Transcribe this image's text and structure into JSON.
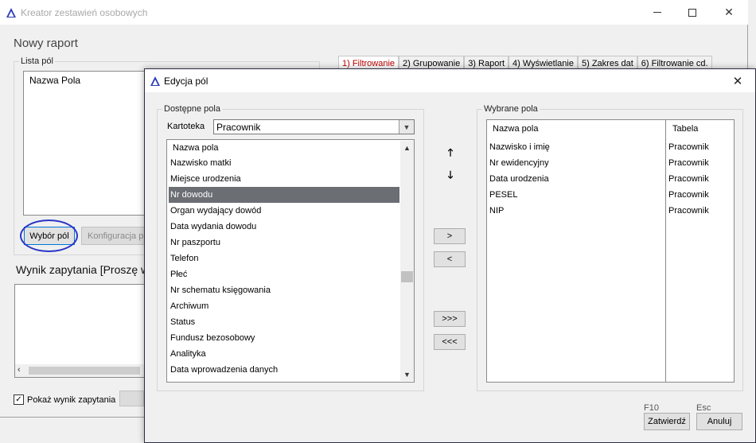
{
  "main_window": {
    "title": "Kreator zestawień osobowych",
    "report_title": "Nowy raport",
    "fields_group_label": "Lista pól",
    "fields_list_header": "Nazwa Pola",
    "choose_fields_button": "Wybór pól",
    "config_button": "Konfiguracja p",
    "tabs": [
      {
        "label": "1) Filtrowanie"
      },
      {
        "label": "2) Grupowanie"
      },
      {
        "label": "3) Raport"
      },
      {
        "label": "4) Wyświetlanie"
      },
      {
        "label": "5) Zakres dat"
      },
      {
        "label": "6) Filtrowanie cd."
      }
    ],
    "query_result_label": "Wynik zapytania [Proszę wy",
    "show_result_checkbox_label": "Pokaż wynik zapytania",
    "show_result_checked": true
  },
  "dialog": {
    "title": "Edycja pól",
    "available_group_label": "Dostępne pola",
    "kartoteka_label": "Kartoteka",
    "kartoteka_value": "Pracownik",
    "available_header": "Nazwa pola",
    "available_items": [
      {
        "label": "Nazwisko matki",
        "selected": false
      },
      {
        "label": "Miejsce urodzenia",
        "selected": false
      },
      {
        "label": "Nr dowodu",
        "selected": true
      },
      {
        "label": "Organ wydający dowód",
        "selected": false
      },
      {
        "label": "Data wydania dowodu",
        "selected": false
      },
      {
        "label": "Nr paszportu",
        "selected": false
      },
      {
        "label": "Telefon",
        "selected": false
      },
      {
        "label": "Płeć",
        "selected": false
      },
      {
        "label": "Nr schematu księgowania",
        "selected": false
      },
      {
        "label": "Archiwum",
        "selected": false
      },
      {
        "label": "Status",
        "selected": false
      },
      {
        "label": "Fundusz bezosobowy",
        "selected": false
      },
      {
        "label": "Analityka",
        "selected": false
      },
      {
        "label": "Data wprowadzenia danych",
        "selected": false
      }
    ],
    "scroll_position": 0.58,
    "move_buttons": {
      "add": ">",
      "remove": "<",
      "add_all": ">>>",
      "remove_all": "<<<"
    },
    "selected_group_label": "Wybrane pola",
    "selected_headers": {
      "name": "Nazwa pola",
      "table": "Tabela"
    },
    "selected_items": [
      {
        "name": "Nazwisko i imię",
        "table": "Pracownik"
      },
      {
        "name": "Nr ewidencyjny",
        "table": "Pracownik"
      },
      {
        "name": "Data urodzenia",
        "table": "Pracownik"
      },
      {
        "name": "PESEL",
        "table": "Pracownik"
      },
      {
        "name": "NIP",
        "table": "Pracownik"
      }
    ],
    "confirm_key": "F10",
    "confirm_button": "Zatwierdź",
    "cancel_key": "Esc",
    "cancel_button": "Anuluj"
  },
  "colors": {
    "selection": "#6b6e73",
    "active_tab_text": "#c00000",
    "annotation_ellipse": "#2a35c8",
    "logo": "#2b3bb8"
  }
}
